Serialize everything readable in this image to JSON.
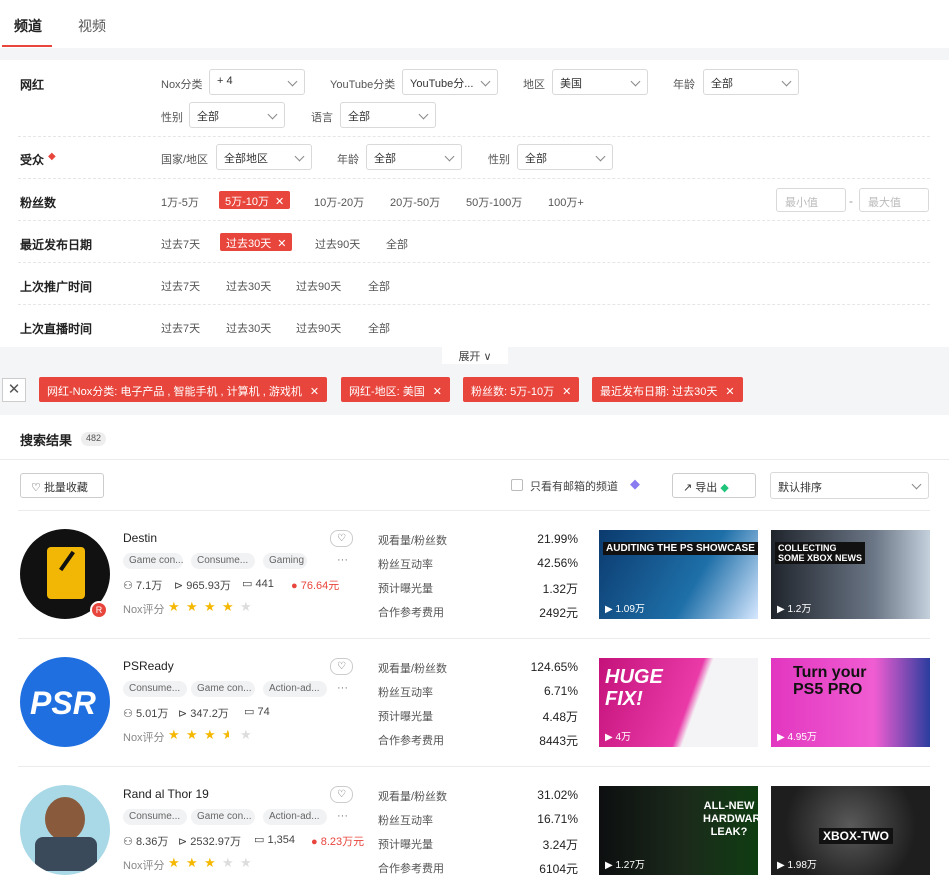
{
  "tabs": {
    "channel": "频道",
    "video": "视频"
  },
  "filters": {
    "influencer": {
      "label": "网红",
      "nox_category_label": "Nox分类",
      "nox_category_value": "+ 4",
      "youtube_category_label": "YouTube分类",
      "youtube_category_value": "YouTube分...",
      "region_label": "地区",
      "region_value": "美国",
      "age_label": "年龄",
      "age_value": "全部",
      "gender_label": "性别",
      "gender_value": "全部",
      "language_label": "语言",
      "language_value": "全部"
    },
    "audience": {
      "label": "受众",
      "country_label": "国家/地区",
      "country_value": "全部地区",
      "age_label": "年龄",
      "age_value": "全部",
      "gender_label": "性别",
      "gender_value": "全部"
    },
    "followers": {
      "label": "粉丝数",
      "options": [
        "1万-5万",
        "5万-10万",
        "10万-20万",
        "20万-50万",
        "50万-100万",
        "100万+"
      ],
      "active": "5万-10万",
      "min_placeholder": "最小值",
      "max_placeholder": "最大值",
      "dash": "-"
    },
    "recent_publish": {
      "label": "最近发布日期",
      "options": [
        "过去7天",
        "过去30天",
        "过去90天",
        "全部"
      ],
      "active": "过去30天"
    },
    "last_promotion": {
      "label": "上次推广时间",
      "options": [
        "过去7天",
        "过去30天",
        "过去90天",
        "全部"
      ]
    },
    "last_live": {
      "label": "上次直播时间",
      "options": [
        "过去7天",
        "过去30天",
        "过去90天",
        "全部"
      ]
    },
    "expand_label": "展开"
  },
  "chips": [
    "网红-Nox分类: 电子产品 , 智能手机 , 计算机 , 游戏机",
    "网红-地区: 美国",
    "粉丝数: 5万-10万",
    "最近发布日期: 过去30天"
  ],
  "results": {
    "title": "搜索结果",
    "count": "482",
    "bulk_save": "批量收藏",
    "email_only": "只看有邮箱的频道",
    "export": "导出",
    "sort_value": "默认排序",
    "metric_labels": [
      "观看量/粉丝数",
      "粉丝互动率",
      "预计曝光量",
      "合作参考费用"
    ],
    "nox_score_label": "Nox评分",
    "channels": [
      {
        "name": "Destin",
        "tags": [
          "Game con...",
          "Consume...",
          "Gaming"
        ],
        "followers": "7.1万",
        "views": "965.93万",
        "videos": "441",
        "price": "76.64元",
        "stars": 4,
        "metrics": [
          "21.99%",
          "42.56%",
          "1.32万",
          "2492元"
        ],
        "thumbs": [
          {
            "count": "1.09万",
            "text": "AUDITING THE PS SHOWCASE"
          },
          {
            "count": "1.2万",
            "text": "COLLECTING SOME XBOX NEWS"
          }
        ]
      },
      {
        "name": "PSReady",
        "tags": [
          "Consume...",
          "Game con...",
          "Action-ad..."
        ],
        "followers": "5.01万",
        "views": "347.2万",
        "videos": "74",
        "price": "",
        "stars": 3.5,
        "metrics": [
          "124.65%",
          "6.71%",
          "4.48万",
          "8443元"
        ],
        "thumbs": [
          {
            "count": "4万",
            "text": "HUGE FIX!"
          },
          {
            "count": "4.95万",
            "text": "Turn your PS5 PRO"
          }
        ]
      },
      {
        "name": "Rand al Thor 19",
        "tags": [
          "Consume...",
          "Game con...",
          "Action-ad..."
        ],
        "followers": "8.36万",
        "views": "2532.97万",
        "videos": "1,354",
        "price": "8.23万元",
        "stars": 3,
        "metrics": [
          "31.02%",
          "16.71%",
          "3.24万",
          "6104元"
        ],
        "thumbs": [
          {
            "count": "1.27万",
            "text": "ALL-NEW HARDWARE LEAK?"
          },
          {
            "count": "1.98万",
            "text": "XBOX-TWO"
          }
        ]
      }
    ]
  },
  "colors": {
    "accent": "#e8453c",
    "star": "#f5b800"
  }
}
